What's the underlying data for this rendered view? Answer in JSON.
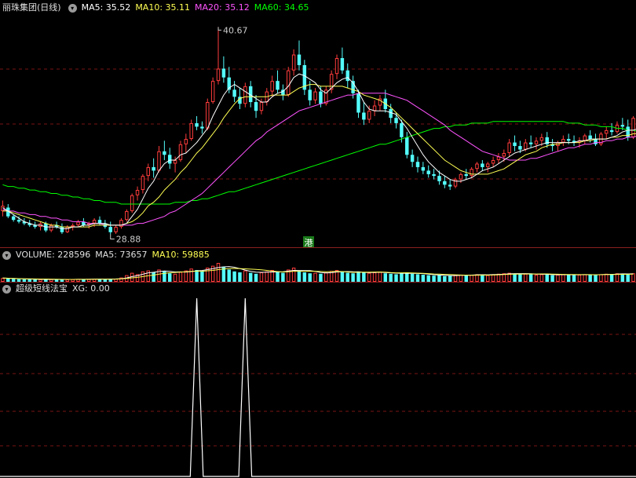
{
  "main_panel": {
    "title": "丽珠集团(日线)",
    "ma5_label": "MA5: 35.52",
    "ma10_label": "MA10: 35.11",
    "ma20_label": "MA20: 35.12",
    "ma60_label": "MA60: 34.65",
    "high_label": "40.67",
    "low_label": "28.88",
    "marker_label": "港"
  },
  "volume_panel": {
    "volume_label": "VOLUME: 228596",
    "ma5_label": "MA5: 73657",
    "ma10_label": "MA10: 59885"
  },
  "indicator_panel": {
    "title": "超级短线法宝",
    "xg_label": "XG: 0.00"
  },
  "colors": {
    "up": "#ff3c3c",
    "down": "#54fcfc",
    "ma5": "#ffffff",
    "ma10": "#ffff54",
    "ma20": "#ff54ff",
    "ma60": "#00ff00",
    "grid": "#7a1414",
    "xg": "#ffffff"
  },
  "chart_data": [
    {
      "type": "candlestick",
      "title": "丽珠集团(日线)",
      "ylim": [
        28.1,
        41.4
      ],
      "high": 40.67,
      "low": 28.88,
      "candles": [
        [
          30.2,
          30.8,
          29.9,
          30.5
        ],
        [
          30.4,
          30.6,
          29.8,
          29.9
        ],
        [
          29.9,
          30.0,
          29.6,
          29.7
        ],
        [
          29.7,
          29.9,
          29.5,
          29.6
        ],
        [
          29.6,
          29.8,
          29.4,
          29.5
        ],
        [
          29.5,
          29.7,
          29.3,
          29.4
        ],
        [
          29.4,
          29.6,
          29.2,
          29.3
        ],
        [
          29.3,
          29.6,
          29.1,
          29.5
        ],
        [
          29.5,
          29.6,
          29.0,
          29.1
        ],
        [
          29.1,
          29.5,
          29.0,
          29.4
        ],
        [
          29.4,
          29.6,
          29.2,
          29.3
        ],
        [
          29.3,
          29.5,
          28.9,
          29.0
        ],
        [
          29.0,
          29.4,
          28.95,
          29.3
        ],
        [
          29.3,
          29.5,
          29.1,
          29.4
        ],
        [
          29.4,
          29.7,
          29.3,
          29.6
        ],
        [
          29.6,
          29.8,
          29.3,
          29.4
        ],
        [
          29.4,
          29.6,
          29.2,
          29.5
        ],
        [
          29.5,
          29.8,
          29.3,
          29.7
        ],
        [
          29.7,
          29.9,
          29.4,
          29.5
        ],
        [
          29.5,
          29.7,
          29.2,
          29.3
        ],
        [
          29.3,
          29.6,
          28.88,
          29.0
        ],
        [
          29.0,
          29.4,
          28.9,
          29.3
        ],
        [
          29.3,
          29.8,
          29.2,
          29.7
        ],
        [
          29.7,
          30.3,
          29.6,
          30.2
        ],
        [
          30.2,
          31.2,
          30.1,
          31.1
        ],
        [
          31.1,
          31.6,
          30.8,
          31.4
        ],
        [
          31.4,
          32.3,
          31.2,
          32.2
        ],
        [
          32.2,
          32.9,
          31.9,
          32.7
        ],
        [
          32.7,
          33.2,
          32.1,
          32.5
        ],
        [
          32.5,
          33.9,
          32.4,
          33.6
        ],
        [
          33.6,
          34.2,
          33.1,
          33.4
        ],
        [
          33.4,
          33.8,
          32.6,
          32.9
        ],
        [
          32.9,
          33.3,
          32.4,
          33.1
        ],
        [
          33.1,
          34.2,
          33.0,
          34.0
        ],
        [
          34.0,
          34.6,
          33.5,
          34.3
        ],
        [
          34.3,
          35.4,
          34.2,
          35.2
        ],
        [
          35.2,
          35.6,
          34.8,
          35.0
        ],
        [
          35.0,
          35.3,
          34.6,
          34.9
        ],
        [
          34.9,
          36.6,
          34.8,
          36.4
        ],
        [
          36.4,
          37.8,
          36.3,
          37.6
        ],
        [
          37.6,
          40.67,
          37.4,
          38.3
        ],
        [
          38.3,
          39.0,
          37.5,
          37.8
        ],
        [
          37.8,
          38.4,
          36.9,
          37.1
        ],
        [
          37.1,
          37.6,
          36.4,
          36.7
        ],
        [
          36.7,
          37.2,
          36.0,
          36.3
        ],
        [
          36.3,
          37.5,
          36.1,
          37.3
        ],
        [
          37.3,
          37.6,
          36.1,
          36.4
        ],
        [
          36.4,
          36.8,
          35.5,
          35.9
        ],
        [
          35.9,
          36.6,
          35.7,
          36.4
        ],
        [
          36.4,
          37.2,
          36.2,
          37.0
        ],
        [
          37.0,
          37.9,
          36.7,
          37.6
        ],
        [
          37.6,
          38.2,
          36.9,
          37.1
        ],
        [
          37.1,
          37.4,
          36.5,
          36.8
        ],
        [
          36.8,
          38.4,
          36.7,
          38.2
        ],
        [
          38.2,
          39.4,
          37.9,
          39.1
        ],
        [
          39.1,
          39.9,
          38.2,
          38.5
        ],
        [
          38.5,
          38.8,
          36.8,
          37.1
        ],
        [
          37.1,
          37.6,
          36.2,
          36.5
        ],
        [
          36.5,
          37.2,
          36.3,
          37.0
        ],
        [
          37.0,
          37.3,
          36.1,
          36.3
        ],
        [
          36.3,
          37.3,
          36.2,
          37.1
        ],
        [
          37.1,
          38.2,
          36.9,
          38.0
        ],
        [
          38.0,
          39.1,
          37.7,
          38.9
        ],
        [
          38.9,
          39.5,
          38.0,
          38.2
        ],
        [
          38.2,
          38.6,
          37.2,
          37.6
        ],
        [
          37.6,
          37.9,
          36.6,
          36.9
        ],
        [
          36.9,
          37.1,
          35.5,
          35.8
        ],
        [
          35.8,
          36.4,
          35.1,
          35.4
        ],
        [
          35.4,
          36.2,
          35.2,
          35.9
        ],
        [
          35.9,
          36.5,
          35.6,
          36.2
        ],
        [
          36.2,
          36.8,
          35.9,
          36.6
        ],
        [
          36.6,
          37.1,
          35.8,
          36.0
        ],
        [
          36.0,
          36.3,
          35.2,
          35.5
        ],
        [
          35.5,
          35.8,
          34.9,
          35.2
        ],
        [
          35.2,
          35.4,
          34.1,
          34.4
        ],
        [
          34.4,
          34.7,
          33.2,
          33.4
        ],
        [
          33.4,
          33.7,
          32.7,
          33.0
        ],
        [
          33.0,
          33.3,
          32.4,
          32.7
        ],
        [
          32.7,
          33.0,
          32.3,
          32.5
        ],
        [
          32.5,
          32.8,
          32.1,
          32.3
        ],
        [
          32.3,
          32.6,
          32.0,
          32.2
        ],
        [
          32.2,
          32.5,
          31.7,
          31.9
        ],
        [
          31.9,
          32.2,
          31.5,
          31.7
        ],
        [
          31.7,
          32.0,
          31.4,
          31.6
        ],
        [
          31.6,
          32.1,
          31.5,
          32.0
        ],
        [
          32.0,
          32.4,
          31.8,
          32.3
        ],
        [
          32.3,
          32.6,
          32.0,
          32.2
        ],
        [
          32.2,
          32.7,
          32.1,
          32.6
        ],
        [
          32.6,
          33.0,
          32.4,
          32.9
        ],
        [
          32.9,
          33.1,
          32.5,
          32.7
        ],
        [
          32.7,
          33.0,
          32.4,
          32.9
        ],
        [
          32.9,
          33.3,
          32.7,
          33.1
        ],
        [
          33.1,
          33.5,
          32.9,
          33.3
        ],
        [
          33.3,
          33.7,
          33.0,
          33.5
        ],
        [
          33.5,
          34.3,
          33.3,
          34.1
        ],
        [
          34.1,
          34.5,
          33.6,
          33.9
        ],
        [
          33.9,
          34.2,
          33.5,
          33.7
        ],
        [
          33.7,
          34.3,
          33.6,
          34.1
        ],
        [
          34.1,
          34.5,
          33.8,
          34.0
        ],
        [
          34.0,
          34.4,
          33.7,
          34.2
        ],
        [
          34.2,
          34.6,
          33.9,
          34.4
        ],
        [
          34.4,
          34.7,
          33.8,
          34.0
        ],
        [
          34.0,
          34.3,
          33.6,
          33.9
        ],
        [
          33.9,
          34.2,
          33.6,
          34.1
        ],
        [
          34.1,
          34.5,
          33.9,
          34.3
        ],
        [
          34.3,
          34.6,
          34.0,
          34.2
        ],
        [
          34.2,
          34.5,
          33.9,
          34.1
        ],
        [
          34.1,
          34.4,
          33.8,
          34.2
        ],
        [
          34.2,
          34.6,
          34.0,
          34.5
        ],
        [
          34.5,
          34.8,
          34.1,
          34.3
        ],
        [
          34.3,
          34.6,
          33.9,
          34.0
        ],
        [
          34.0,
          34.7,
          33.9,
          34.6
        ],
        [
          34.6,
          35.0,
          34.3,
          34.8
        ],
        [
          34.8,
          35.2,
          34.5,
          34.7
        ],
        [
          34.7,
          35.3,
          34.6,
          35.1
        ],
        [
          35.1,
          35.5,
          34.8,
          35.0
        ],
        [
          35.0,
          35.4,
          34.2,
          34.4
        ],
        [
          34.4,
          35.6,
          34.3,
          35.5
        ]
      ],
      "ma5": [
        30.4,
        30.2,
        30.0,
        29.8,
        29.6,
        29.5,
        29.4,
        29.4,
        29.3,
        29.3,
        29.3,
        29.2,
        29.2,
        29.3,
        29.3,
        29.4,
        29.4,
        29.5,
        29.5,
        29.5,
        29.4,
        29.4,
        29.4,
        29.5,
        29.9,
        30.3,
        30.9,
        31.5,
        31.9,
        32.5,
        32.9,
        33.1,
        33.1,
        33.4,
        33.5,
        33.8,
        34.1,
        34.5,
        34.9,
        35.6,
        36.2,
        36.8,
        37.2,
        37.4,
        37.2,
        37.0,
        36.8,
        36.6,
        36.4,
        36.4,
        36.7,
        36.9,
        37.0,
        37.3,
        37.8,
        38.0,
        37.9,
        37.7,
        37.5,
        37.1,
        36.9,
        37.2,
        37.5,
        37.7,
        37.8,
        37.5,
        37.0,
        36.4,
        36.0,
        35.9,
        35.9,
        35.9,
        35.8,
        35.7,
        35.3,
        34.9,
        34.4,
        33.9,
        33.4,
        33.0,
        32.7,
        32.4,
        32.2,
        32.0,
        31.9,
        31.9,
        32.0,
        32.1,
        32.3,
        32.5,
        32.6,
        32.7,
        32.9,
        33.1,
        33.3,
        33.5,
        33.6,
        33.7,
        33.8,
        33.9,
        34.0,
        34.1,
        34.1,
        34.1,
        34.1,
        34.1,
        34.1,
        34.2,
        34.2,
        34.3,
        34.3,
        34.3,
        34.3,
        34.4,
        34.5,
        34.7,
        34.8,
        34.8,
        34.9
      ],
      "ma10": [
        30.2,
        30.2,
        30.1,
        30.0,
        29.9,
        29.8,
        29.7,
        29.6,
        29.5,
        29.4,
        29.4,
        29.3,
        29.3,
        29.3,
        29.3,
        29.3,
        29.3,
        29.4,
        29.4,
        29.4,
        29.4,
        29.4,
        29.4,
        29.5,
        29.6,
        29.8,
        30.1,
        30.5,
        30.7,
        31.0,
        31.4,
        31.7,
        32.0,
        32.4,
        32.7,
        33.1,
        33.5,
        33.8,
        34.2,
        34.6,
        35.0,
        35.5,
        35.9,
        36.3,
        36.6,
        36.7,
        36.7,
        36.7,
        36.7,
        36.7,
        36.8,
        36.8,
        36.8,
        36.8,
        37.0,
        37.2,
        37.3,
        37.4,
        37.4,
        37.3,
        37.3,
        37.3,
        37.3,
        37.3,
        37.2,
        37.1,
        37.0,
        36.8,
        36.7,
        36.6,
        36.5,
        36.3,
        36.1,
        35.8,
        35.5,
        35.2,
        34.9,
        34.6,
        34.3,
        34.0,
        33.7,
        33.4,
        33.1,
        32.9,
        32.7,
        32.5,
        32.4,
        32.3,
        32.3,
        32.3,
        32.3,
        32.4,
        32.5,
        32.6,
        32.8,
        33.0,
        33.2,
        33.4,
        33.5,
        33.6,
        33.8,
        33.9,
        34.0,
        34.0,
        34.1,
        34.1,
        34.1,
        34.1,
        34.2,
        34.2,
        34.3,
        34.3,
        34.3,
        34.4,
        34.4,
        34.5,
        34.5,
        34.6,
        34.6
      ],
      "ma20": [
        30.3,
        30.2,
        30.2,
        30.1,
        30.1,
        30.0,
        30.0,
        29.9,
        29.9,
        29.8,
        29.8,
        29.7,
        29.7,
        29.6,
        29.6,
        29.6,
        29.5,
        29.5,
        29.5,
        29.4,
        29.4,
        29.4,
        29.4,
        29.4,
        29.4,
        29.5,
        29.5,
        29.6,
        29.7,
        29.8,
        29.9,
        30.1,
        30.2,
        30.4,
        30.6,
        30.8,
        31.0,
        31.2,
        31.5,
        31.8,
        32.1,
        32.4,
        32.7,
        33.0,
        33.3,
        33.6,
        33.9,
        34.2,
        34.4,
        34.7,
        34.9,
        35.1,
        35.3,
        35.5,
        35.7,
        35.9,
        36.0,
        36.1,
        36.2,
        36.3,
        36.4,
        36.5,
        36.6,
        36.7,
        36.8,
        36.8,
        36.9,
        36.9,
        36.9,
        36.9,
        36.9,
        36.9,
        36.8,
        36.7,
        36.6,
        36.5,
        36.3,
        36.1,
        35.9,
        35.7,
        35.5,
        35.3,
        35.1,
        34.8,
        34.6,
        34.4,
        34.2,
        34.0,
        33.8,
        33.6,
        33.5,
        33.4,
        33.3,
        33.2,
        33.1,
        33.1,
        33.1,
        33.1,
        33.2,
        33.2,
        33.3,
        33.4,
        33.5,
        33.6,
        33.7,
        33.8,
        33.8,
        33.9,
        34.0,
        34.0,
        34.1,
        34.1,
        34.2,
        34.2,
        34.3,
        34.3,
        34.4,
        34.4,
        34.5
      ],
      "ma60": [
        31.7,
        31.6,
        31.6,
        31.5,
        31.5,
        31.4,
        31.4,
        31.3,
        31.3,
        31.2,
        31.2,
        31.1,
        31.1,
        31.0,
        31.0,
        30.9,
        30.9,
        30.8,
        30.8,
        30.7,
        30.7,
        30.7,
        30.6,
        30.6,
        30.6,
        30.6,
        30.6,
        30.6,
        30.6,
        30.6,
        30.6,
        30.6,
        30.7,
        30.7,
        30.7,
        30.8,
        30.8,
        30.9,
        30.9,
        31.0,
        31.1,
        31.2,
        31.3,
        31.3,
        31.4,
        31.5,
        31.6,
        31.7,
        31.8,
        31.9,
        32.0,
        32.1,
        32.2,
        32.3,
        32.4,
        32.5,
        32.6,
        32.7,
        32.8,
        32.9,
        33.0,
        33.1,
        33.2,
        33.3,
        33.4,
        33.5,
        33.6,
        33.7,
        33.8,
        33.9,
        34.0,
        34.0,
        34.1,
        34.2,
        34.3,
        34.4,
        34.5,
        34.6,
        34.7,
        34.8,
        34.9,
        34.9,
        35.0,
        35.0,
        35.1,
        35.1,
        35.1,
        35.2,
        35.2,
        35.2,
        35.2,
        35.3,
        35.3,
        35.3,
        35.3,
        35.3,
        35.3,
        35.3,
        35.3,
        35.3,
        35.3,
        35.3,
        35.3,
        35.3,
        35.3,
        35.2,
        35.2,
        35.2,
        35.1,
        35.1,
        35.1,
        35.0,
        35.0,
        35.0,
        34.9,
        34.9,
        34.8,
        34.8,
        34.7
      ]
    },
    {
      "type": "bar",
      "title": "VOLUME",
      "ylim": [
        0,
        200000
      ],
      "values": [
        40,
        35,
        30,
        28,
        26,
        25,
        24,
        26,
        25,
        27,
        24,
        22,
        25,
        27,
        30,
        26,
        28,
        32,
        29,
        27,
        30,
        33,
        45,
        70,
        95,
        80,
        110,
        120,
        100,
        130,
        115,
        90,
        85,
        105,
        120,
        140,
        125,
        110,
        150,
        170,
        200,
        160,
        130,
        110,
        100,
        120,
        95,
        85,
        100,
        110,
        125,
        105,
        95,
        130,
        150,
        120,
        100,
        90,
        95,
        85,
        100,
        115,
        125,
        105,
        95,
        90,
        110,
        100,
        95,
        100,
        105,
        90,
        85,
        80,
        95,
        100,
        85,
        80,
        75,
        70,
        65,
        70,
        60,
        65,
        70,
        75,
        70,
        75,
        80,
        75,
        70,
        80,
        85,
        90,
        95,
        85,
        80,
        85,
        80,
        75,
        80,
        75,
        70,
        75,
        80,
        75,
        70,
        75,
        80,
        75,
        70,
        80,
        85,
        80,
        90,
        85,
        75,
        90
      ],
      "unit_multiplier": 1000
    },
    {
      "type": "line",
      "title": "超级短线法宝",
      "series": [
        {
          "name": "XG",
          "spikes_at": [
            36,
            45
          ]
        }
      ],
      "ylim": [
        0,
        1
      ]
    }
  ]
}
